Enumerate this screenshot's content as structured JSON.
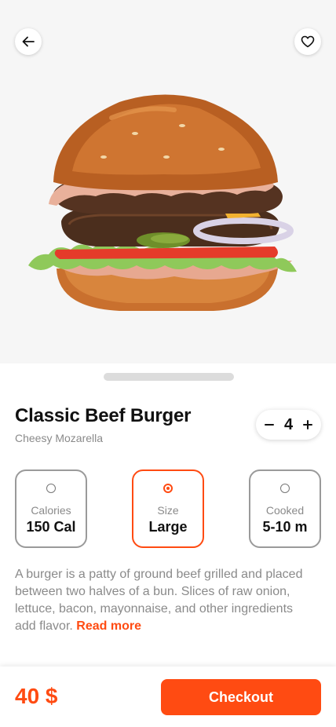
{
  "header": {
    "back_icon": "arrow-left-icon",
    "favorite_icon": "heart-icon"
  },
  "product": {
    "image": "burger-photo",
    "name": "Classic Beef Burger",
    "subtitle": "Cheesy Mozarella",
    "quantity": "4",
    "description": "A burger is a patty of ground beef grilled and placed between two halves of a bun. Slices of raw onion, lettuce, bacon, mayonnaise, and other ingredients add flavor.",
    "read_more": "Read more"
  },
  "options": [
    {
      "label": "Calories",
      "value": "150 Cal",
      "selected": false
    },
    {
      "label": "Size",
      "value": "Large",
      "selected": true
    },
    {
      "label": "Cooked",
      "value": "5-10 m",
      "selected": false
    }
  ],
  "footer": {
    "price": "40 $",
    "checkout_label": "Checkout"
  },
  "colors": {
    "accent": "#ff4b12",
    "muted_text": "#8a8a8a",
    "hero_bg": "#f6f6f6"
  }
}
